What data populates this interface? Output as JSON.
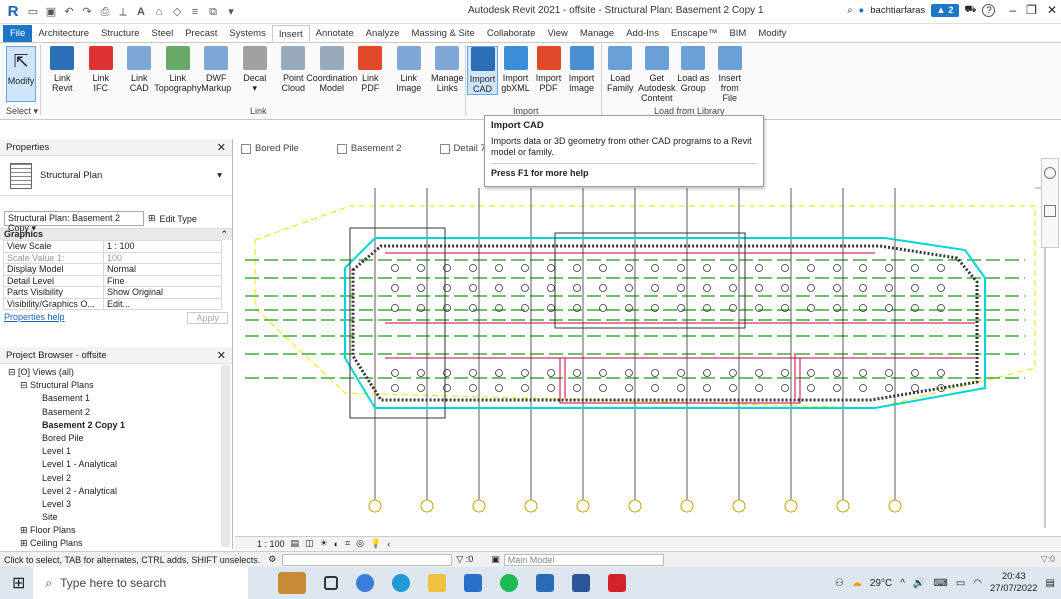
{
  "titlebar": {
    "title": "Autodesk Revit 2021 - offsite - Structural Plan: Basement 2 Copy 1",
    "user": "bachtiarfaras",
    "alerts": "2",
    "help": "?"
  },
  "tabs": [
    "File",
    "Architecture",
    "Structure",
    "Steel",
    "Precast",
    "Systems",
    "Insert",
    "Annotate",
    "Analyze",
    "Massing & Site",
    "Collaborate",
    "View",
    "Manage",
    "Add-Ins",
    "Enscape™",
    "BIM",
    "Modify"
  ],
  "active_tab": "Insert",
  "ribbon": {
    "select_label": "Select ▾",
    "modify": "Modify",
    "link": [
      {
        "l1": "Link",
        "l2": "Revit"
      },
      {
        "l1": "Link",
        "l2": "IFC"
      },
      {
        "l1": "Link",
        "l2": "CAD"
      },
      {
        "l1": "Link",
        "l2": "Topography"
      },
      {
        "l1": "DWF",
        "l2": "Markup"
      },
      {
        "l1": "Decal",
        "l2": "▾"
      },
      {
        "l1": "Point",
        "l2": "Cloud"
      },
      {
        "l1": "Coordination",
        "l2": "Model"
      },
      {
        "l1": "Link",
        "l2": "PDF"
      },
      {
        "l1": "Link",
        "l2": "Image"
      },
      {
        "l1": "Manage",
        "l2": "Links"
      }
    ],
    "link_panel": "Link",
    "import": [
      {
        "l1": "Import",
        "l2": "CAD"
      },
      {
        "l1": "Import",
        "l2": "gbXML"
      },
      {
        "l1": "Import",
        "l2": "PDF"
      },
      {
        "l1": "Import",
        "l2": "Image"
      }
    ],
    "import_panel": "Import",
    "library": [
      {
        "l1": "Load",
        "l2": "Family"
      },
      {
        "l1": "Get Autodesk",
        "l2": "Content"
      },
      {
        "l1": "Load as",
        "l2": "Group"
      },
      {
        "l1": "Insert",
        "l2": "from File"
      }
    ],
    "library_panel": "Load from Library"
  },
  "tooltip": {
    "title": "Import CAD",
    "desc": "Imports data or 3D geometry from other CAD programs to a Revit model or family.",
    "help": "Press F1 for more help"
  },
  "view_tabs": [
    "Bored Pile",
    "Basement 2",
    "Detail 7"
  ],
  "properties": {
    "title": "Properties",
    "type": "Structural Plan",
    "instance": "Structural Plan: Basement 2 Copy",
    "edit_type": "Edit Type",
    "group": "Graphics",
    "rows": [
      {
        "k": "View Scale",
        "v": "1 : 100"
      },
      {
        "k": "Scale Value  1:",
        "v": "100"
      },
      {
        "k": "Display Model",
        "v": "Normal"
      },
      {
        "k": "Detail Level",
        "v": "Fine"
      },
      {
        "k": "Parts Visibility",
        "v": "Show Original"
      },
      {
        "k": "Visibility/Graphics O...",
        "v": "Edit..."
      }
    ],
    "help": "Properties help",
    "apply": "Apply"
  },
  "browser": {
    "title": "Project Browser - offsite",
    "nodes": [
      {
        "t": "⊟ [O] Views (all)",
        "d": 0
      },
      {
        "t": "⊟ Structural Plans",
        "d": 1
      },
      {
        "t": "Basement 1",
        "d": 2
      },
      {
        "t": "Basement 2",
        "d": 2
      },
      {
        "t": "Basement 2 Copy 1",
        "d": 2,
        "bold": true
      },
      {
        "t": "Bored Pile",
        "d": 2
      },
      {
        "t": "Level 1",
        "d": 2
      },
      {
        "t": "Level 1 - Analytical",
        "d": 2
      },
      {
        "t": "Level 2",
        "d": 2
      },
      {
        "t": "Level 2 - Analytical",
        "d": 2
      },
      {
        "t": "Level 3",
        "d": 2
      },
      {
        "t": "Site",
        "d": 2
      },
      {
        "t": "⊞ Floor Plans",
        "d": 1
      },
      {
        "t": "⊞ Ceiling Plans",
        "d": 1
      }
    ]
  },
  "viewbar": {
    "scale": "1 : 100"
  },
  "status": {
    "hint": "Click to select, TAB for alternates, CTRL adds, SHIFT unselects.",
    "zero": ":0",
    "model": "Main Model",
    "filter": ":0"
  },
  "taskbar": {
    "search": "Type here to search",
    "temp": "29°C",
    "time": "20:43",
    "date": "27/07/2022"
  },
  "colors": {
    "accent": "#1d77c6",
    "slab": "#00d6d6",
    "grid": "#1a9a1a",
    "beam": "#c8003c",
    "dashed": "#e6e600"
  }
}
